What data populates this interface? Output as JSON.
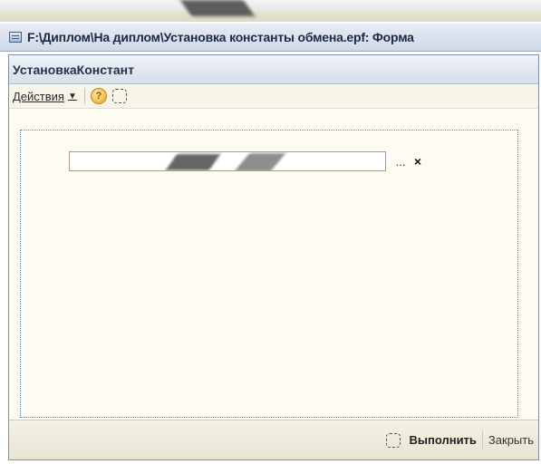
{
  "window": {
    "title": "F:\\Диплом\\На диплом\\Установка константы обмена.epf: Форма"
  },
  "form": {
    "title": "УстановкаКонстант",
    "toolbar": {
      "actions_label": "Действия",
      "help_icon_char": "?"
    },
    "field": {
      "value": "",
      "ellipsis_label": "...",
      "clear_label": "×"
    },
    "footer": {
      "run_label": "Выполнить",
      "close_label": "Закрыть"
    }
  }
}
